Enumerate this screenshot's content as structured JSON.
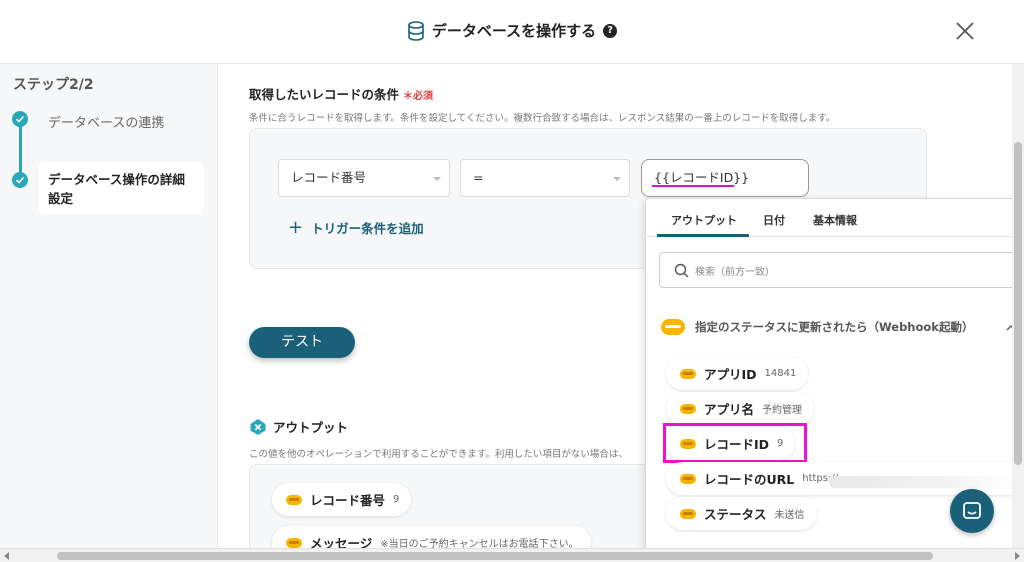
{
  "header": {
    "title": "データベースを操作する",
    "help": "?"
  },
  "sidebar": {
    "step_title": "ステップ2/2",
    "steps": [
      {
        "label": "データベースの連携"
      },
      {
        "label": "データベース操作の詳細設定"
      }
    ]
  },
  "condition": {
    "title": "取得したいレコードの条件",
    "required_mark": "＊必須",
    "description": "条件に合うレコードを取得します。条件を設定してください。複数行合致する場合は、レスポンス結果の一番上のレコードを取得します。",
    "field_select": "レコード番号",
    "operator_select": "=",
    "value": "{{レコードID}}",
    "add_trigger": "トリガー条件を追加"
  },
  "test_button": "テスト",
  "output": {
    "title": "アウトプット",
    "description": "この値を他のオペレーションで利用することができます。利用したい項目がない場合は、",
    "items": [
      {
        "name": "レコード番号",
        "value": "9"
      },
      {
        "name": "メッセージ",
        "value": "※当日のご予約キャンセルはお電話下さい。"
      }
    ]
  },
  "popup": {
    "tabs": [
      "アウトプット",
      "日付",
      "基本情報"
    ],
    "active_tab": "アウトプット",
    "search_placeholder": "検索（前方一致）",
    "group_title": "指定のステータスに更新されたら（Webhook起動）",
    "items": [
      {
        "name": "アプリID",
        "value": "14841"
      },
      {
        "name": "アプリ名",
        "value": "予約管理"
      },
      {
        "name": "レコードID",
        "value": "9"
      },
      {
        "name": "レコードのURL",
        "value": "https://"
      },
      {
        "name": "ステータス",
        "value": "未送信"
      }
    ]
  },
  "colors": {
    "accent": "#1a6079",
    "step": "#2aa7b7",
    "required": "#e53e3e",
    "highlight": "#f012d2",
    "kintone": "#f7b500"
  }
}
